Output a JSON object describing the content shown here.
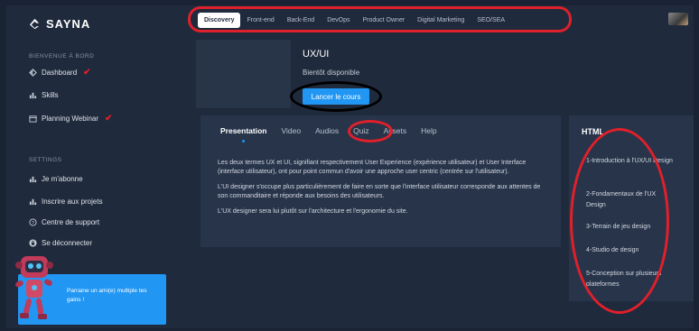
{
  "brand": {
    "name": "SAYNA"
  },
  "topnav": {
    "tabs": [
      {
        "label": "Discovery",
        "active": true
      },
      {
        "label": "Front-end",
        "active": false
      },
      {
        "label": "Back-End",
        "active": false
      },
      {
        "label": "DevOps",
        "active": false
      },
      {
        "label": "Product Owner",
        "active": false
      },
      {
        "label": "Digital Marketing",
        "active": false
      },
      {
        "label": "SEO/SEA",
        "active": false
      }
    ]
  },
  "sidebar": {
    "section1": "BIENVENUE À BORD",
    "items1": [
      {
        "label": "Dashboard",
        "icon": "dashboard-icon",
        "checked": true
      },
      {
        "label": "Skills",
        "icon": "bar-chart-icon",
        "checked": false
      },
      {
        "label": "Planning Webinar",
        "icon": "calendar-icon",
        "checked": true
      }
    ],
    "section2": "SETTINGS",
    "items2": [
      {
        "label": "Je m'abonne",
        "icon": "bar-chart-icon"
      },
      {
        "label": "Inscrire aux projets",
        "icon": "bar-chart-icon"
      },
      {
        "label": "Centre de support",
        "icon": "help-icon"
      },
      {
        "label": "Se déconnecter",
        "icon": "lock-icon"
      }
    ]
  },
  "promo": {
    "text": "Parraine un ami(e) multiple tes gains !"
  },
  "course": {
    "title": "UX/UI",
    "status": "Bientôt disponible",
    "launch_label": "Lancer le cours"
  },
  "panel": {
    "tabs": [
      {
        "label": "Presentation",
        "active": true
      },
      {
        "label": "Video",
        "active": false
      },
      {
        "label": "Audios",
        "active": false
      },
      {
        "label": "Quiz",
        "active": false
      },
      {
        "label": "Assets",
        "active": false
      },
      {
        "label": "Help",
        "active": false
      }
    ],
    "paragraphs": [
      "Les deux termes UX et UI, signifiant respectivement User Experience (expérience utilisateur) et User Interface (interface utilisateur), ont pour point commun d'avoir une approche user centric (centrée sur l'utilisateur).",
      "L'UI designer s'occupe plus particulièrement de faire en sorte que l'interface utilisateur corresponde aux attentes de son commanditaire et réponde aux besoins des utilisateurs.",
      "L'UX designer sera lui plutôt sur l'architecture et l'ergonomie du site."
    ]
  },
  "lessons": {
    "title": "HTML",
    "items": [
      "1-Introduction à l'UX/UI Design",
      "2-Fondamentaux de l'UX Design",
      "3-Terrain de jeu design",
      "4-Studio de design",
      "5-Conception sur plusieurs plateformes"
    ]
  },
  "colors": {
    "accent": "#2196f3",
    "annotation": "#e0202a",
    "background": "#1f2a3c",
    "panel": "#27344a"
  }
}
